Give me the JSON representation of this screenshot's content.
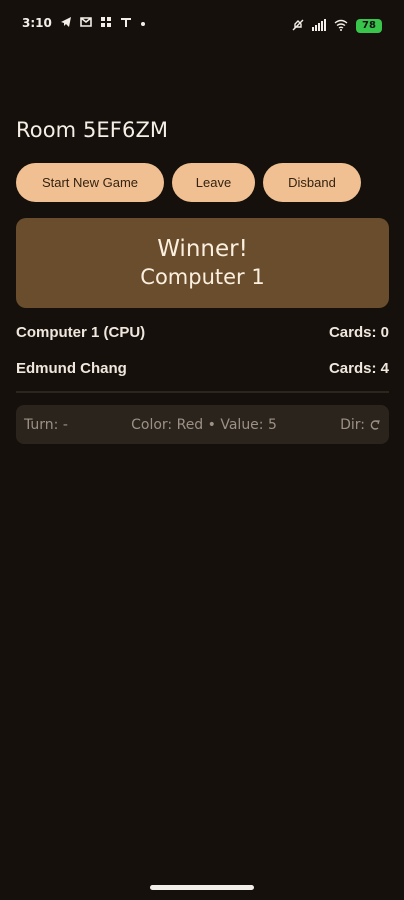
{
  "status_bar": {
    "time": "3:10",
    "battery": "78"
  },
  "room": {
    "title": "Room 5EF6ZM"
  },
  "actions": {
    "start_label": "Start New Game",
    "leave_label": "Leave",
    "disband_label": "Disband"
  },
  "winner": {
    "heading": "Winner!",
    "name": "Computer 1"
  },
  "players": [
    {
      "name": "Computer 1 (CPU)",
      "cards": "Cards: 0"
    },
    {
      "name": "Edmund Chang",
      "cards": "Cards: 4"
    }
  ],
  "info": {
    "turn": "Turn: -",
    "color_value": "Color: Red • Value: 5",
    "dir": "Dir:"
  },
  "colors": {
    "background": "#15100b",
    "accent": "#f0c093",
    "winner_card": "#6a4d2c",
    "battery": "#39c44c"
  },
  "icons": {
    "telegram": "telegram-icon",
    "mail": "mail-icon",
    "network": "network-icon",
    "t_mobile": "t-mobile-icon",
    "mute": "mute-icon",
    "signal": "signal-icon",
    "wifi": "wifi-icon",
    "direction": "direction-icon"
  }
}
